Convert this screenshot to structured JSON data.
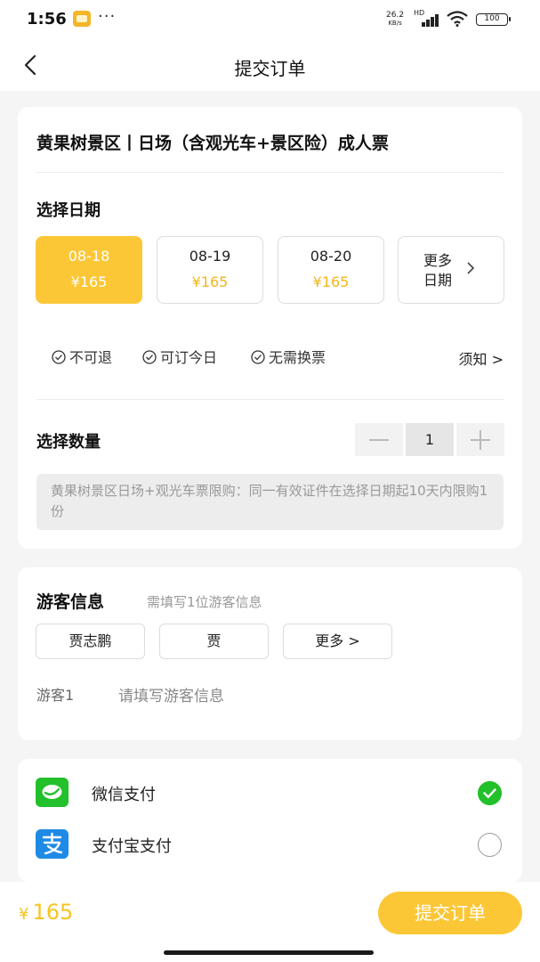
{
  "status_bar": {
    "time": "1:56",
    "more_dots": "···",
    "net_speed_value": "26.2",
    "net_speed_unit": "KB/s",
    "network_type": "HD",
    "battery": "100"
  },
  "nav": {
    "title": "提交订单"
  },
  "product": {
    "title": "黄果树景区丨日场（含观光车+景区险）成人票"
  },
  "date_section": {
    "label": "选择日期",
    "options": [
      {
        "date": "08-18",
        "price": "¥165",
        "selected": true
      },
      {
        "date": "08-19",
        "price": "¥165",
        "selected": false
      },
      {
        "date": "08-20",
        "price": "¥165",
        "selected": false
      }
    ],
    "more_line1": "更多",
    "more_line2": "日期"
  },
  "features": [
    "不可退",
    "可订今日",
    "无需换票"
  ],
  "notice_link": "须知 >",
  "quantity_section": {
    "label": "选择数量",
    "value": "1",
    "limit_notice": "黄果树景区日场+观光车票限购：同一有效证件在选择日期起10天内限购1份"
  },
  "visitor_section": {
    "title": "游客信息",
    "hint": "需填写1位游客信息",
    "chips": [
      "贾志鹏",
      "贾",
      "更多 >"
    ],
    "slot_label": "游客1",
    "slot_hint": "请填写游客信息"
  },
  "payment": {
    "options": [
      {
        "label": "微信支付",
        "icon": "wechat-pay-icon",
        "checked": true
      },
      {
        "label": "支付宝支付",
        "icon": "alipay-icon",
        "checked": false
      }
    ]
  },
  "bottom_bar": {
    "currency": "¥",
    "total": "165",
    "submit_label": "提交订单"
  },
  "colors": {
    "accent": "#fcc737",
    "price": "#f2b61e",
    "wechat_green": "#22c02a",
    "alipay_blue": "#1f8ae6"
  }
}
